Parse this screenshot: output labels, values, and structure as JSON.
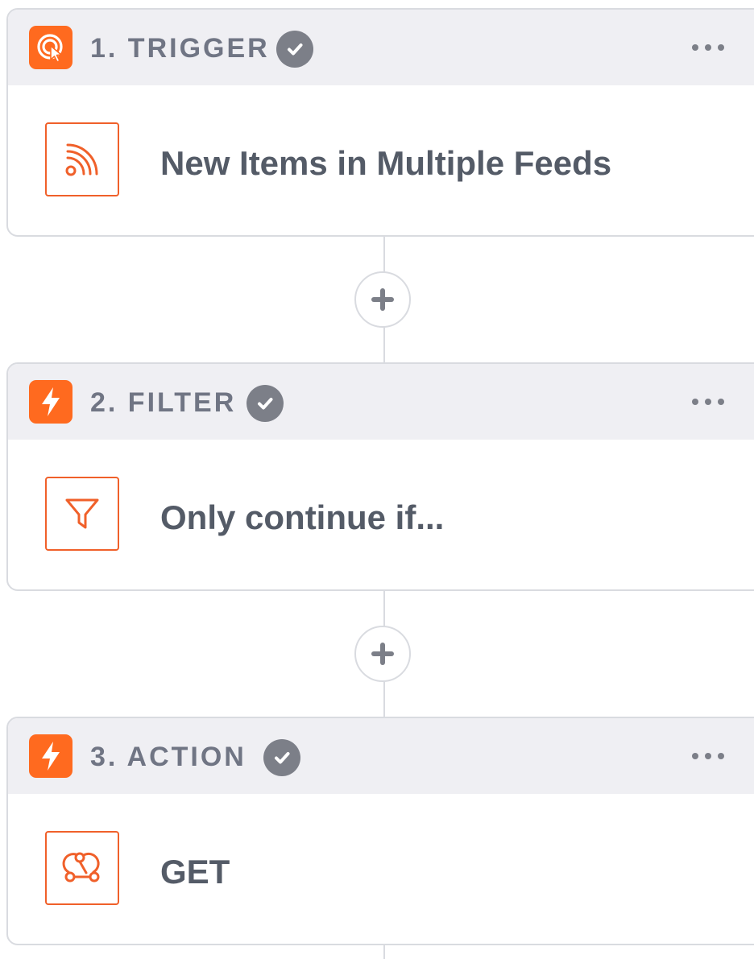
{
  "steps": [
    {
      "title": "1. TRIGGER",
      "icon": "trigger-cursor-icon",
      "app_icon": "rss-feed-icon",
      "label": "New Items in Multiple Feeds"
    },
    {
      "title": "2. FILTER",
      "icon": "lightning-icon",
      "app_icon": "filter-funnel-icon",
      "label": "Only continue if..."
    },
    {
      "title": "3. ACTION",
      "icon": "lightning-icon",
      "app_icon": "webhook-icon",
      "label": "GET"
    }
  ],
  "colors": {
    "accent": "#ff6a1f",
    "app_icon_border": "#f0602a",
    "header_bg": "#efeff3",
    "title_text": "#707584",
    "label_text": "#545b67",
    "check_bg": "#7c7f88",
    "border": "#d9dbe0"
  }
}
